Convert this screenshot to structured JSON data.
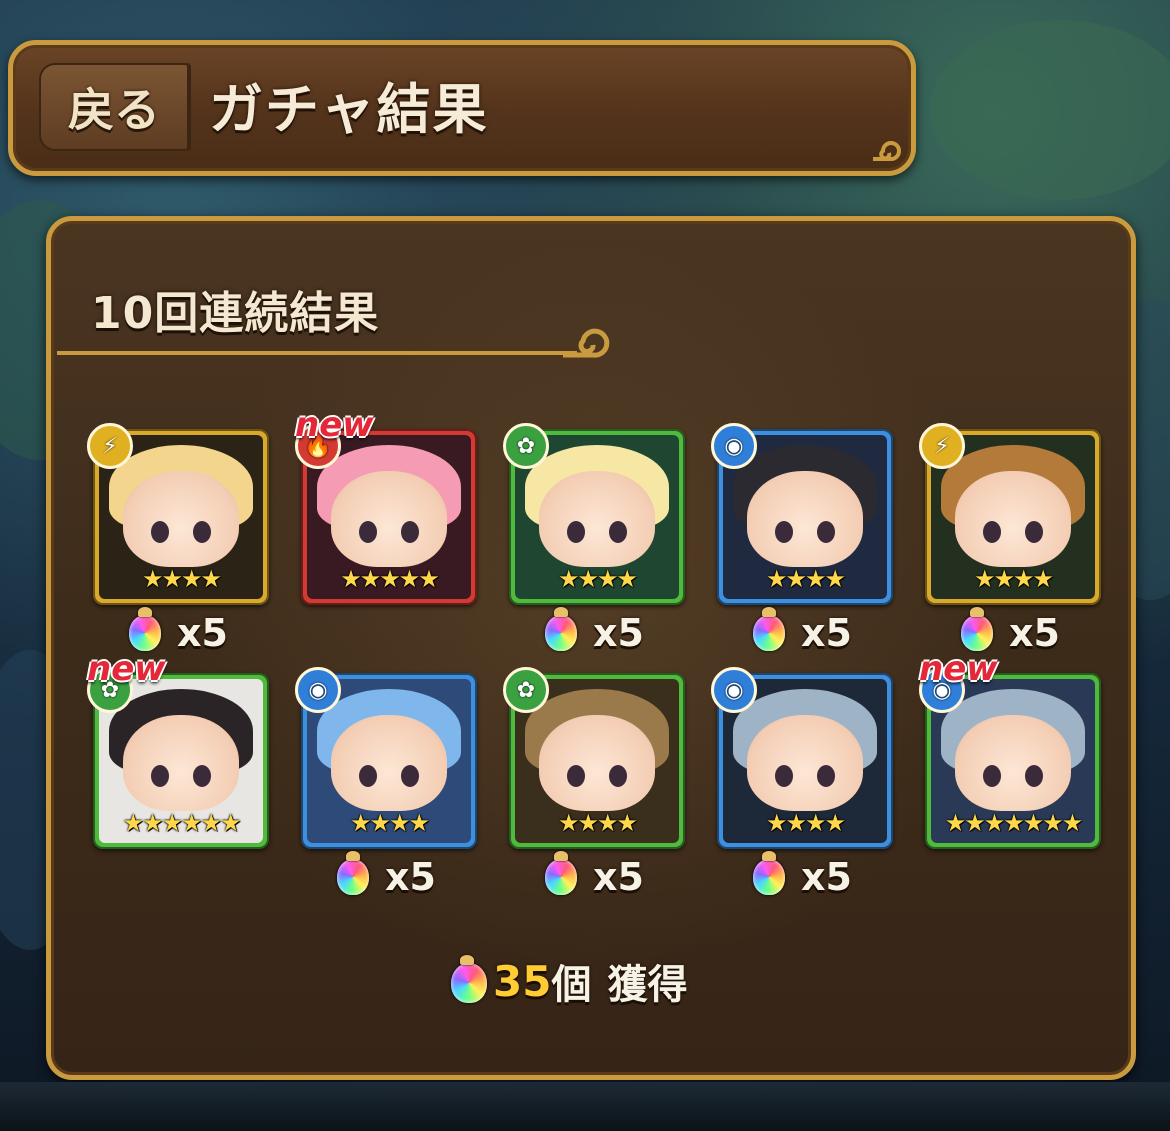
{
  "header": {
    "back_label": "戻る",
    "title": "ガチャ結果"
  },
  "panel": {
    "title": "10回連続結果"
  },
  "results": [
    {
      "element": "thunder",
      "element_icon": "⚡",
      "stars": "★★★★",
      "is_new": false,
      "new_label": "",
      "fragment_label": "x5",
      "frame": "#d9a92b",
      "bg": "#2b2416",
      "hair": "#f3d58e"
    },
    {
      "element": "fire",
      "element_icon": "🔥",
      "stars": "★★★★★",
      "is_new": true,
      "new_label": "new",
      "fragment_label": "",
      "frame": "#d23a32",
      "bg": "#3a1a22",
      "hair": "#f59bb4"
    },
    {
      "element": "wood",
      "element_icon": "✿",
      "stars": "★★★★",
      "is_new": false,
      "new_label": "",
      "fragment_label": "x5",
      "frame": "#4fbb3c",
      "bg": "#1f4630",
      "hair": "#f6e7a4"
    },
    {
      "element": "water",
      "element_icon": "◉",
      "stars": "★★★★",
      "is_new": false,
      "new_label": "",
      "fragment_label": "x5",
      "frame": "#3d8fe0",
      "bg": "#1f2a40",
      "hair": "#2a2a30"
    },
    {
      "element": "thunder",
      "element_icon": "⚡",
      "stars": "★★★★",
      "is_new": false,
      "new_label": "",
      "fragment_label": "x5",
      "frame": "#d9a92b",
      "bg": "#24301f",
      "hair": "#b37a3a"
    },
    {
      "element": "wood",
      "element_icon": "✿",
      "stars": "★★★★★★",
      "is_new": true,
      "new_label": "new",
      "fragment_label": "",
      "frame": "#4fbb3c",
      "bg": "#e8e6e2",
      "hair": "#2b2426"
    },
    {
      "element": "water",
      "element_icon": "◉",
      "stars": "★★★★",
      "is_new": false,
      "new_label": "",
      "fragment_label": "x5",
      "frame": "#3d8fe0",
      "bg": "#2d4a78",
      "hair": "#7fb6ec"
    },
    {
      "element": "wood",
      "element_icon": "✿",
      "stars": "★★★★",
      "is_new": false,
      "new_label": "",
      "fragment_label": "x5",
      "frame": "#4fbb3c",
      "bg": "#3a2e1c",
      "hair": "#9a7a4a"
    },
    {
      "element": "water",
      "element_icon": "◉",
      "stars": "★★★★",
      "is_new": false,
      "new_label": "",
      "fragment_label": "x5",
      "frame": "#3d8fe0",
      "bg": "#1d2838",
      "hair": "#9fb3c6"
    },
    {
      "element": "water",
      "element_icon": "◉",
      "stars": "★★★★★★★",
      "is_new": true,
      "new_label": "new",
      "fragment_label": "",
      "frame": "#4fbb3c",
      "bg": "#2a3a56",
      "hair": "#9fb3c6"
    }
  ],
  "total": {
    "count": "35",
    "unit": "個",
    "label": "獲得"
  },
  "colors": {
    "gold_border": "#c99a3e",
    "panel_bg": "#3d2b1a",
    "count_yellow": "#ffcc33"
  }
}
